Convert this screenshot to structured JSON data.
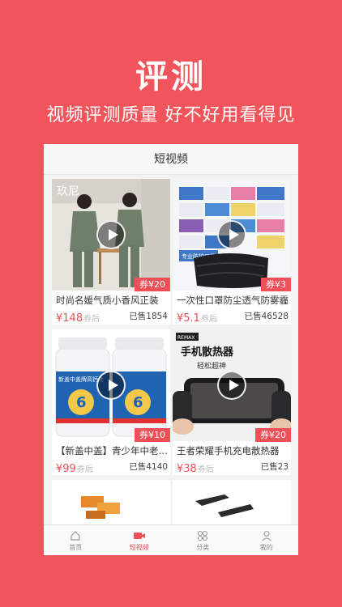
{
  "hero": {
    "title": "评测",
    "subtitle": "视频评测质量  好不好用看得见"
  },
  "screen": {
    "header_title": "短视频",
    "products": [
      {
        "title": "时尚名媛气质小香风正装",
        "coupon": "券¥20",
        "price": "¥148",
        "price_suffix": "券后",
        "sold": "已售1854"
      },
      {
        "title": "一次性口罩防尘透气防雾霾",
        "coupon": "券¥3",
        "price": "¥5.1",
        "price_suffix": "券后",
        "sold": "已售46528"
      },
      {
        "title": "【新盖中盖】青少年中老年钙片",
        "coupon": "券¥10",
        "price": "¥99",
        "price_suffix": "券后",
        "sold": "已售4140"
      },
      {
        "title": "王者荣耀手机充电散热器",
        "coupon": "券¥20",
        "price": "¥38",
        "price_suffix": "券后",
        "sold": "已售23"
      }
    ],
    "thumb_texts": {
      "jacket_brand": "玖尼",
      "mask_label": "专业防护口罩",
      "calcium_brand": "新盖中盖牌高钙片",
      "fan_brand": "REMAX",
      "fan_title": "手机散热器",
      "fan_sub": "轻松超神"
    },
    "tabs": [
      {
        "label": "首页",
        "icon": "home-icon",
        "active": false
      },
      {
        "label": "短视频",
        "icon": "video-camera-icon",
        "active": true
      },
      {
        "label": "分类",
        "icon": "category-icon",
        "active": false
      },
      {
        "label": "我的",
        "icon": "user-icon",
        "active": false
      }
    ],
    "colors": {
      "accent": "#ef4f57",
      "background": "#f2545b"
    }
  }
}
